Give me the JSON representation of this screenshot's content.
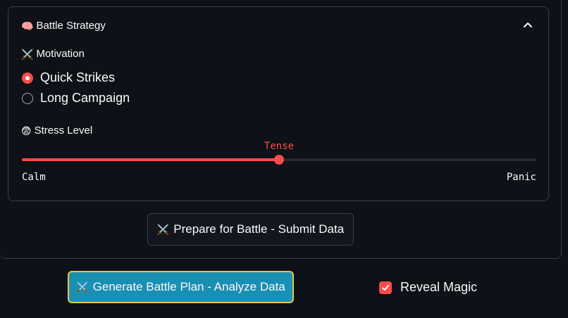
{
  "expander": {
    "icon": "🧠",
    "title": "Battle Strategy",
    "expanded": true
  },
  "motivation": {
    "icon": "⚔️",
    "label": "Motivation",
    "options": [
      "Quick Strikes",
      "Long Campaign"
    ],
    "selected_index": 0
  },
  "stress": {
    "icon": "😨",
    "label": "Stress Level",
    "value": "Tense",
    "min_label": "Calm",
    "max_label": "Panic",
    "position_fraction": 0.5
  },
  "buttons": {
    "submit_icon": "⚔️",
    "submit_label": "Prepare for Battle - Submit Data",
    "generate_icon": "⚔️",
    "generate_label": "Generate Battle Plan - Analyze Data"
  },
  "reveal": {
    "label": "Reveal Magic",
    "checked": true
  },
  "colors": {
    "accent": "#ff4b4b",
    "primary_button": "#1a8fb4",
    "focus_border": "#e6c84a"
  }
}
